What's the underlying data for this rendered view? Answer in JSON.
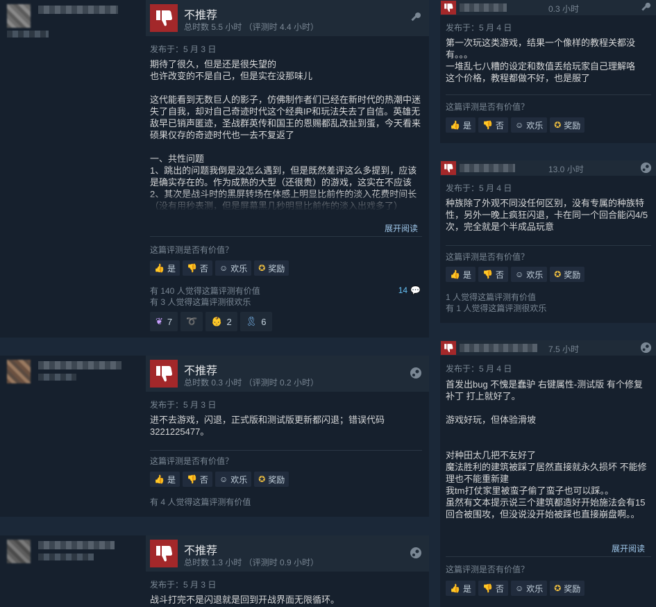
{
  "common": {
    "verdict": "不推荐",
    "helpful_question": "这篇评测是否有价值？",
    "btn_yes": "是",
    "btn_no": "否",
    "btn_funny": "欢乐",
    "btn_award": "奖励",
    "read_more": "展开阅读"
  },
  "review1": {
    "hours": "总时数 5.5 小时 （评测时 4.4 小时）",
    "posted": "发布于：5 月 3 日",
    "body": "期待了很久，但是还是很失望的\n也许改变的不是自己，但是实在没那味儿\n\n这代能看到无数巨人的影子，仿佛制作者们已经在新时代的热潮中迷失了自我，却对自己奇迹时代这个经典IP和玩法失去了自信。英雄无敌早已销声匿迹，圣战群英传和国王的恩赐都乱改扯到蛋，今天看来硕果仅存的奇迹时代也一去不复返了\n\n一、共性问题\n1、跳出的问题我倒是没怎么遇到，但是既然差评这么多提到，应该是确实存在的。作为成熟的大型（还很贵）的游戏，这实在不应该\n2、其次是战斗时的黑屏转场在体感上明显比前作的淡入花费时间长（没有用秒表测，但是屏幕黑几秒明显比前作的淡入出戏多了）",
    "stat1": "有 140 人觉得这篇评测有价值",
    "stat2": "有 3 人觉得这篇评测很欢乐",
    "comments": "14",
    "awards": [
      {
        "icon": "butterfly-icon",
        "count": "7"
      },
      {
        "icon": "hotdog-icon",
        "count": ""
      },
      {
        "icon": "baby-face-icon",
        "count": "2"
      },
      {
        "icon": "ribbon-icon",
        "count": "6"
      }
    ]
  },
  "review2": {
    "hours": "总时数 0.3 小时 （评测时 0.2 小时）",
    "posted": "发布于：5 月 3 日",
    "body": "进不去游戏，闪退，正式版和测试版更新都闪退；错误代码\n3221225477。",
    "stat1": "有 4 人觉得这篇评测有价值"
  },
  "review3": {
    "hours": "总时数 1.3 小时 （评测时 0.9 小时）",
    "posted": "发布于：5 月 3 日",
    "body": "战斗打完不是闪退就是回到开战界面无限循环。"
  },
  "right1": {
    "hours": "0.3 小时",
    "posted": "发布于：5 月 4 日",
    "body": "第一次玩这类游戏，结果一个像样的教程关都没有。。。\n一堆乱七八糟的设定和数值丢给玩家自己理解咯\n这个价格，教程都做不好，也是服了"
  },
  "right2": {
    "hours": "13.0 小时",
    "posted": "发布于：5 月 4 日",
    "body": "种族除了外观不同没任何区别，没有专属的种族特性，另外一晚上疯狂闪退，卡在同一个回合能闪4/5次，完全就是个半成品玩意",
    "stat1": "1 人觉得这篇评测有价值",
    "stat2": "有 1 人觉得这篇评测很欢乐"
  },
  "right3": {
    "hours": "7.5 小时",
    "posted": "发布于：5 月 4 日",
    "body": "首发出bug 不愧是蠢驴 右键属性-测试版 有个修复补丁 打上就好了。\n\n游戏好玩，但体验滑坡\n\n\n对种田太几把不友好了\n魔法胜利的建筑被踩了居然直接就永久损坏 不能修理也不能重新建\n我tm打仗家里被蛮子偷了蛮子也可以踩。。\n虽然有文本提示说三个建筑都造好开始施法会有15回合被围攻，但没说没开始被踩也直接崩盘啊。。"
  },
  "colors": {
    "thumb_red": "#a3282a",
    "link_blue": "#66c0f4"
  }
}
